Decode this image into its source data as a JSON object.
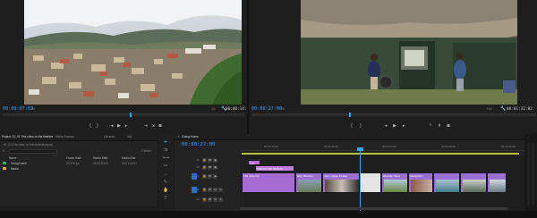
{
  "source_monitor": {
    "timecode": "00:00:07:03",
    "fit_label": "Fit",
    "page": "1/1",
    "duration": "00:00:14:19"
  },
  "program_monitor": {
    "timecode": "00:00:27:00",
    "fit_label": "Fit",
    "page": "Full",
    "duration": "00:01:32:02"
  },
  "project": {
    "title": "Project: 01_01 This class on the timeline",
    "tabs": [
      "Media Browser",
      "Libraries",
      "Info"
    ],
    "path": "01_01 This class on the timeline.prproj",
    "item_count": "2 Items",
    "columns": [
      "Name",
      "Frame Rate",
      "Media Start",
      "Media End"
    ],
    "rows": [
      {
        "name": "Going Home",
        "rate": "23.976 fps",
        "start": "00:00:00:00",
        "end": "00:01:32:01"
      },
      {
        "name": "Media",
        "rate": "",
        "start": "",
        "end": ""
      }
    ]
  },
  "sequence": {
    "tab": "Going Home",
    "timecode": "00:00:27:00",
    "ruler": [
      "00:00:16:00",
      "00:00:20:00",
      "00:00:24:00",
      "00:00:28:00",
      "00:00:32:00"
    ],
    "tracks": [
      "V3",
      "V2",
      "V1",
      "A1",
      "A2"
    ],
    "clips": {
      "v3_title": "Title",
      "v2_title": "Title/Intro clip: Media B",
      "v1_first": "Pink video bar",
      "v1_second": "Blog Title/Intro",
      "v1_third": "Amb. college footage",
      "v1_fourth": "Mountain Town",
      "v1_fifth": "Intersection"
    }
  },
  "colors": {
    "accent_blue": "#3ba0ff",
    "clip_pink": "#b870d8",
    "clip_purple": "#9a6fd0"
  }
}
